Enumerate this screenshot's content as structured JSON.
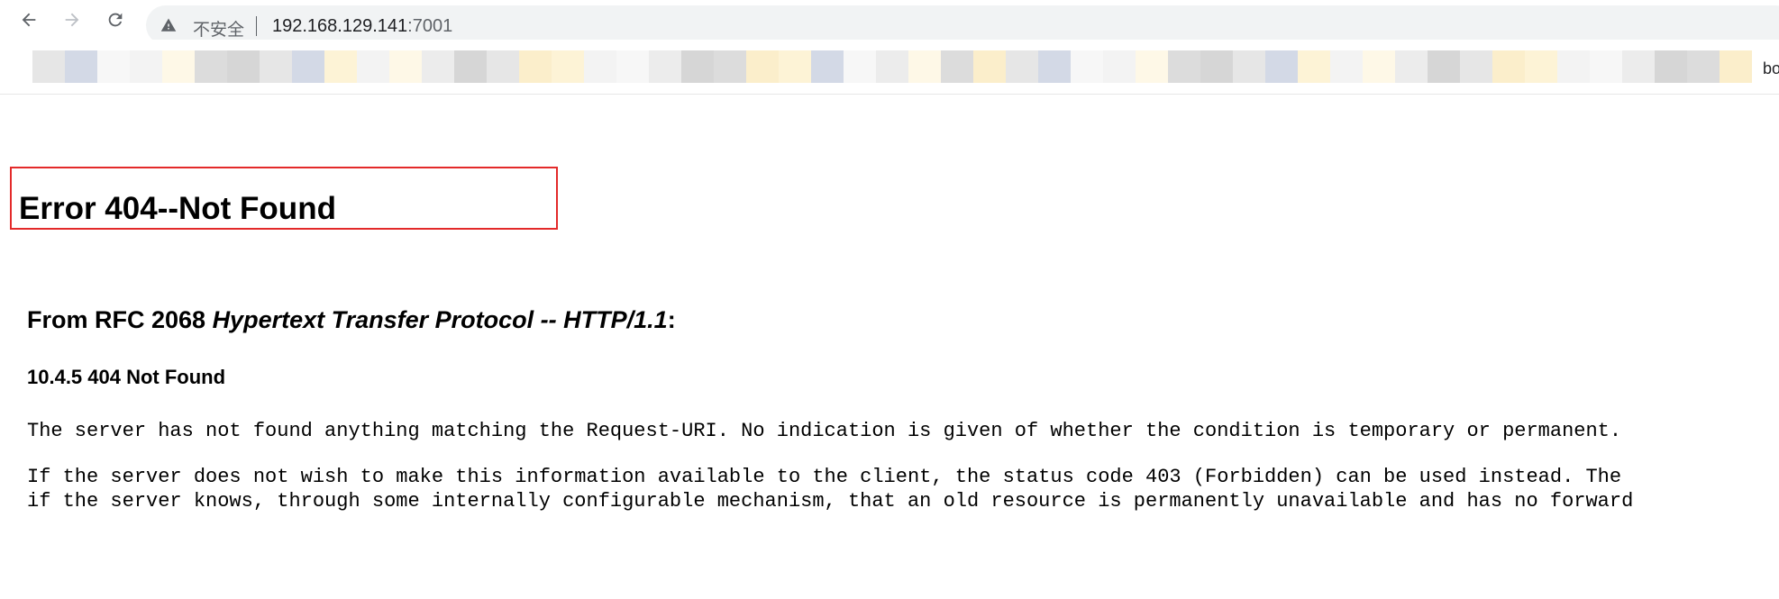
{
  "browser": {
    "not_secure_label": "不安全",
    "url_host": "192.168.129.141",
    "url_port": ":7001",
    "bookmark_tail_text": "bo"
  },
  "icons": {
    "back": "back-arrow-icon",
    "forward": "forward-arrow-icon",
    "reload": "reload-icon",
    "warning": "warning-triangle-icon"
  },
  "colors": {
    "highlight_border": "#e32a2a",
    "omnibox_bg": "#f1f3f4"
  },
  "page": {
    "error_title": "Error 404--Not Found",
    "rfc_prefix": "From RFC 2068 ",
    "rfc_title": "Hypertext Transfer Protocol -- HTTP/1.1",
    "rfc_suffix": ":",
    "section_heading": "10.4.5 404 Not Found",
    "para1": "The server has not found anything matching the Request-URI. No indication is given of whether the condition is temporary or permanent.",
    "para2_line1": "If the server does not wish to make this information available to the client, the status code 403 (Forbidden) can be used instead. The",
    "para2_line2": "if the server knows, through some internally configurable mechanism, that an old resource is permanently unavailable and has no forward"
  }
}
